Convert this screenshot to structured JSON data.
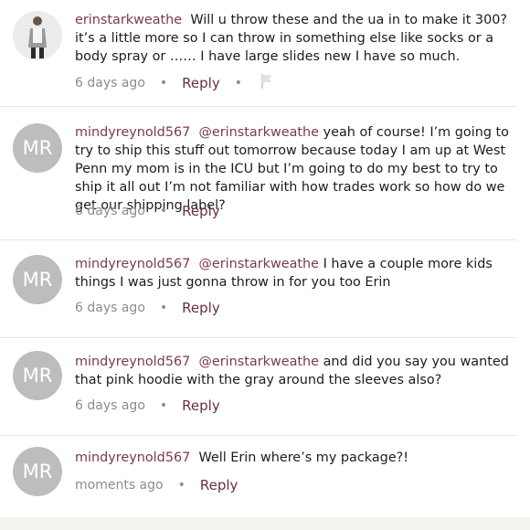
{
  "comments": [
    {
      "user": "erinstarkweathe",
      "mention": "",
      "text": "Will u throw these and the ua in to make it 300?it’s a little more so I can throw in something else like socks or a body spray or …… I have large slides new I have so much.",
      "time": "6 days ago",
      "reply_label": "Reply",
      "avatar_type": "photo"
    },
    {
      "user": "mindyreynold567",
      "mention": "@erinstarkweathe",
      "text": "yeah of course! I’m going to try to ship this stuff out tomorrow because today I am up at West Penn my mom is in the ICU but I’m going to do my best to try to ship it all out I’m not familiar with how trades work so how do we get our shipping label?",
      "time": "6 days ago",
      "reply_label": "Reply",
      "avatar_initials": "MR"
    },
    {
      "user": "mindyreynold567",
      "mention": "@erinstarkweathe",
      "text": "I have a couple more kids things I was just gonna throw in for you too Erin",
      "time": "6 days ago",
      "reply_label": "Reply",
      "avatar_initials": "MR"
    },
    {
      "user": "mindyreynold567",
      "mention": "@erinstarkweathe",
      "text": "and did you say you wanted that pink hoodie with the gray around the sleeves also?",
      "time": "6 days ago",
      "reply_label": "Reply",
      "avatar_initials": "MR"
    },
    {
      "user": "mindyreynold567",
      "mention": "",
      "text": "Well Erin where’s my package?!",
      "time": "moments ago",
      "reply_label": "Reply",
      "avatar_initials": "MR"
    }
  ],
  "separator": "•",
  "colors": {
    "username": "#7a3a4e",
    "reply": "#6b2e43",
    "avatar_bg": "#bdbdbd",
    "meta": "#8c8c8c",
    "divider": "#e9e7e4"
  },
  "icons": {
    "flag": "flag-icon"
  }
}
